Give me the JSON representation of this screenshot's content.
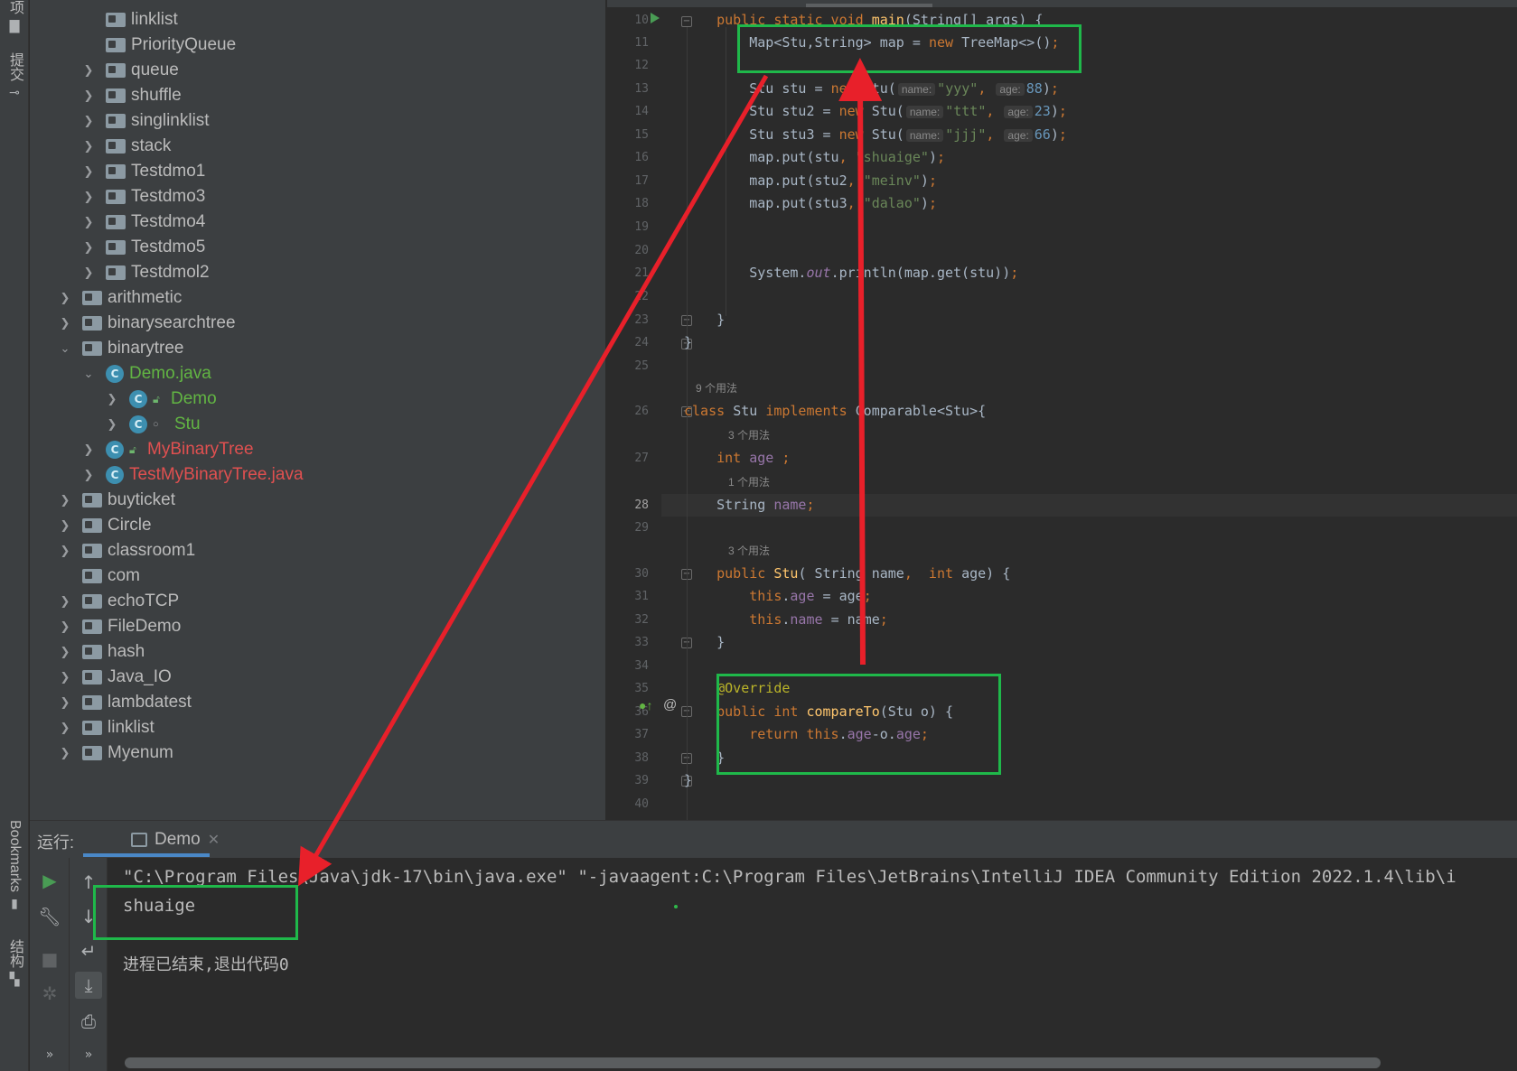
{
  "left_strip": {
    "top_tab_glyph": "项",
    "commit_tab": "提交",
    "bookmarks_tab": "Bookmarks",
    "structure_tab": "结构"
  },
  "project_tree": {
    "items": [
      {
        "label": "linklist",
        "expandable": false,
        "icon": "folder-icon",
        "color": "default"
      },
      {
        "label": "PriorityQueue",
        "expandable": false,
        "icon": "folder-icon",
        "color": "default"
      },
      {
        "label": "queue",
        "expandable": true,
        "icon": "folder-icon",
        "color": "default"
      },
      {
        "label": "shuffle",
        "expandable": true,
        "icon": "folder-icon",
        "color": "default"
      },
      {
        "label": "singlinklist",
        "expandable": true,
        "icon": "folder-icon",
        "color": "default"
      },
      {
        "label": "stack",
        "expandable": true,
        "icon": "folder-icon",
        "color": "default"
      },
      {
        "label": "Testdmo1",
        "expandable": true,
        "icon": "folder-icon",
        "color": "default"
      },
      {
        "label": "Testdmo3",
        "expandable": true,
        "icon": "folder-icon",
        "color": "default"
      },
      {
        "label": "Testdmo4",
        "expandable": true,
        "icon": "folder-icon",
        "color": "default"
      },
      {
        "label": "Testdmo5",
        "expandable": true,
        "icon": "folder-icon",
        "color": "default"
      },
      {
        "label": "Testdmol2",
        "expandable": true,
        "icon": "folder-icon",
        "color": "default"
      },
      {
        "label": "arithmetic",
        "expandable": true,
        "icon": "folder-icon",
        "color": "default"
      },
      {
        "label": "binarysearchtree",
        "expandable": true,
        "icon": "folder-icon",
        "color": "default"
      },
      {
        "label": "binarytree",
        "expandable": true,
        "expanded": true,
        "icon": "folder-icon",
        "color": "default"
      },
      {
        "label": "Demo.java",
        "expandable": true,
        "expanded": true,
        "icon": "class-icon",
        "color": "green"
      },
      {
        "label": "Demo",
        "expandable": true,
        "icon": "class-icon",
        "color": "green"
      },
      {
        "label": "Stu",
        "expandable": true,
        "icon": "class-icon",
        "color": "green"
      },
      {
        "label": "MyBinaryTree",
        "expandable": true,
        "icon": "class-icon",
        "color": "red"
      },
      {
        "label": "TestMyBinaryTree.java",
        "expandable": true,
        "icon": "class-icon",
        "color": "red"
      },
      {
        "label": "buyticket",
        "expandable": true,
        "icon": "folder-icon",
        "color": "default"
      },
      {
        "label": "Circle",
        "expandable": true,
        "icon": "folder-icon",
        "color": "default"
      },
      {
        "label": "classroom1",
        "expandable": true,
        "icon": "folder-icon",
        "color": "default"
      },
      {
        "label": "com",
        "expandable": false,
        "icon": "folder-icon",
        "color": "default"
      },
      {
        "label": "echoTCP",
        "expandable": true,
        "icon": "folder-icon",
        "color": "default"
      },
      {
        "label": "FileDemo",
        "expandable": true,
        "icon": "folder-icon",
        "color": "default"
      },
      {
        "label": "hash",
        "expandable": true,
        "icon": "folder-icon",
        "color": "default"
      },
      {
        "label": "Java_IO",
        "expandable": true,
        "icon": "folder-icon",
        "color": "default"
      },
      {
        "label": "lambdatest",
        "expandable": true,
        "icon": "folder-icon",
        "color": "default"
      },
      {
        "label": "linklist",
        "expandable": true,
        "icon": "folder-icon",
        "color": "default"
      },
      {
        "label": "Myenum",
        "expandable": true,
        "icon": "folder-icon",
        "color": "default"
      }
    ]
  },
  "editor": {
    "line_numbers": [
      "10",
      "11",
      "12",
      "13",
      "14",
      "15",
      "16",
      "17",
      "18",
      "19",
      "20",
      "21",
      "22",
      "23",
      "24",
      "25",
      "26",
      "27",
      "28",
      "29",
      "30",
      "31",
      "32",
      "33",
      "34",
      "35",
      "36",
      "37",
      "38",
      "39",
      "40"
    ],
    "current_line": "28",
    "usage_hints": {
      "class_stu": "9 个用法",
      "field_age": "3 个用法",
      "field_name": "1 个用法",
      "constructor": "3 个用法"
    },
    "param_hints": {
      "name": "name:",
      "age": "age:"
    },
    "strings": {
      "yyy": "\"yyy\"",
      "ttt": "\"ttt\"",
      "jjj": "\"jjj\"",
      "shuaige": "\"shuaige\"",
      "meinv": "\"meinv\"",
      "dalao": "\"dalao\""
    },
    "numbers": {
      "n88": "88",
      "n23": "23",
      "n66": "66"
    }
  },
  "run_panel": {
    "label": "运行:",
    "tab_label": "Demo",
    "console_command": "\"C:\\Program Files\\Java\\jdk-17\\bin\\java.exe\" \"-javaagent:C:\\Program Files\\JetBrains\\IntelliJ IDEA Community Edition 2022.1.4\\lib\\i",
    "console_output": "shuaige",
    "console_exit": "进程已结束,退出代码0"
  },
  "colors": {
    "annotation_box": "#1fb84a",
    "annotation_arrow": "#e8202a",
    "keyword": "#cc7832",
    "string": "#6a8759",
    "number": "#6897bb",
    "field": "#9876aa"
  }
}
